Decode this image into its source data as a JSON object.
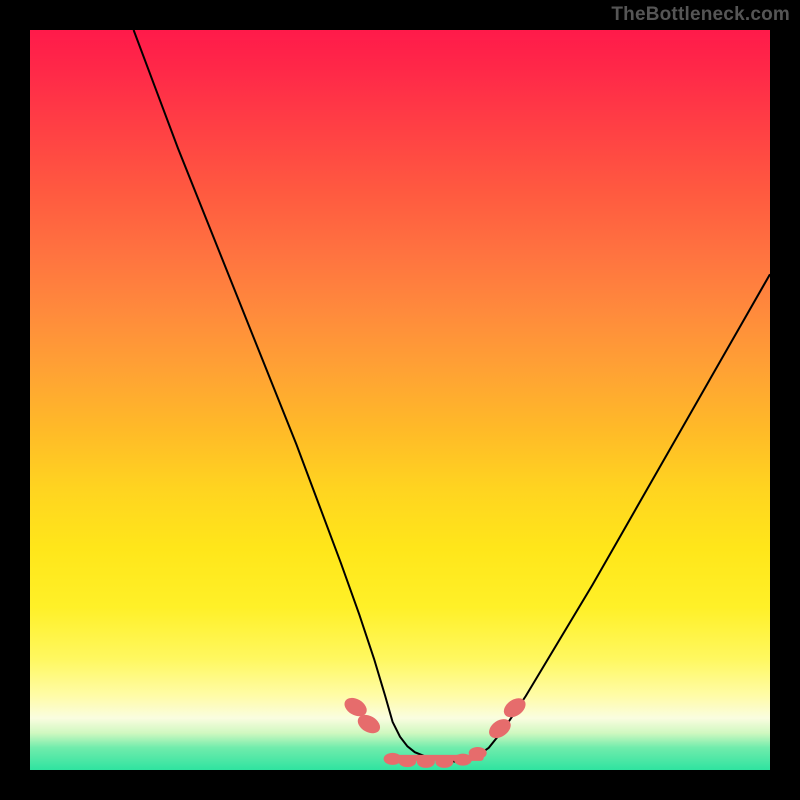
{
  "watermark": "TheBottleneck.com",
  "chart_data": {
    "type": "line",
    "title": "",
    "xlabel": "",
    "ylabel": "",
    "xlim": [
      0,
      100
    ],
    "ylim": [
      0,
      100
    ],
    "grid": false,
    "series": [
      {
        "name": "curve-left",
        "x": [
          14,
          17,
          20,
          24,
          28,
          32,
          36,
          39,
          42,
          44.5,
          46.5,
          48,
          49.0,
          50,
          51,
          52,
          53.5,
          55,
          56.5,
          58
        ],
        "y": [
          100,
          92,
          84,
          74,
          64,
          54,
          44,
          36,
          28,
          21,
          15,
          10,
          6.5,
          4.5,
          3.2,
          2.4,
          1.8,
          1.4,
          1.2,
          1.1
        ]
      },
      {
        "name": "curve-right",
        "x": [
          58,
          60,
          62,
          64,
          67,
          70,
          73,
          76,
          80,
          84,
          88,
          92,
          96,
          100
        ],
        "y": [
          1.1,
          1.6,
          3.0,
          5.5,
          10,
          15,
          20,
          25,
          32,
          39,
          46,
          53,
          60,
          67
        ]
      }
    ],
    "markers": {
      "bottom_beads_x": [
        49.0,
        51.0,
        53.5,
        56.0,
        58.5,
        60.5
      ],
      "bottom_beads_y": [
        1.5,
        1.2,
        1.1,
        1.1,
        1.4,
        2.3
      ],
      "left_pair_x": [
        44.0,
        45.8
      ],
      "left_pair_y": [
        8.5,
        6.2
      ],
      "right_pair_x": [
        63.5,
        65.5
      ],
      "right_pair_y": [
        5.6,
        8.4
      ]
    },
    "background_gradient": {
      "top": "#ff1a4a",
      "bottom": "#2fe3a0"
    }
  }
}
